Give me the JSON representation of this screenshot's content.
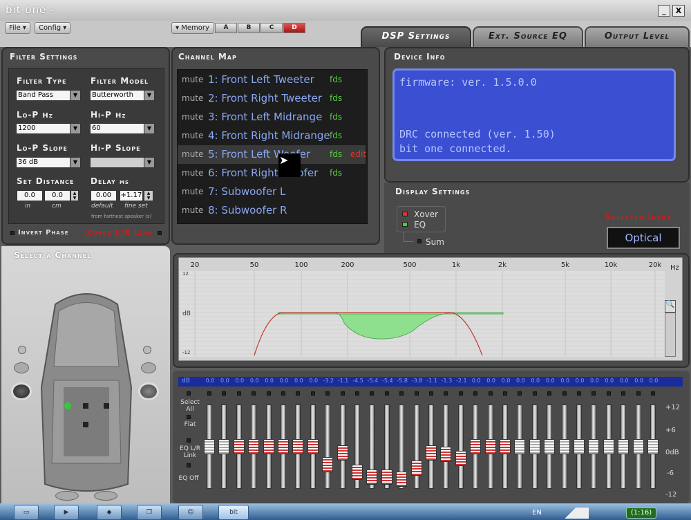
{
  "window": {
    "title": "bit one -",
    "minimize_label": "_",
    "close_label": "X"
  },
  "menu": {
    "file": "File",
    "config": "Config"
  },
  "memory": {
    "label": "Memory",
    "slots": [
      "A",
      "B",
      "C",
      "D"
    ],
    "active": "D"
  },
  "tabs": [
    "DSP Settings",
    "Ext. Source EQ",
    "Output Level"
  ],
  "filter_settings": {
    "title": "Filter Settings",
    "filter_type_label": "Filter Type",
    "filter_type_value": "Band Pass",
    "filter_model_label": "Filter Model",
    "filter_model_value": "Butterworth",
    "lop_label": "Lo-P",
    "lop_unit": "Hz",
    "lop_value": "1200",
    "hip_label": "Hi-P",
    "hip_unit": "Hz",
    "hip_value": "60",
    "lop_slope_label": "Lo-P Slope",
    "lop_slope_value": "36 dB",
    "hip_slope_label": "Hi-P Slope",
    "hip_slope_value": "",
    "distance_label": "Set Distance",
    "distance_in": "0.0",
    "distance_cm": "0.0",
    "in_label": "in",
    "cm_label": "cm",
    "delay_label": "Delay",
    "delay_unit": "ms",
    "delay_default": "0.00",
    "delay_fine": "+1.17",
    "default_label": "default",
    "fine_set_label": "fine set",
    "from_label": "from farthest speaker (s)",
    "invert_phase": "Invert Phase",
    "xover_link": "Xover L/R Link"
  },
  "channel_map": {
    "title": "Channel Map",
    "mute_label": "mute",
    "fds_label": "fds",
    "edit_label": "edit",
    "channels": [
      "1: Front Left Tweeter",
      "2: Front Right Tweeter",
      "3: Front Left Midrange",
      "4: Front Right Midrange",
      "5: Front Left Woofer",
      "6: Front Right Woofer",
      "7: Subwoofer L",
      "8: Subwoofer R"
    ],
    "selected": 5
  },
  "device_info": {
    "title": "Device Info",
    "firmware": "firmware: ver. 1.5.0.0",
    "drc": "DRC connected (ver. 1.50)",
    "bitone": "bit one connected."
  },
  "display_settings": {
    "title": "Display Settings",
    "xover": "Xover",
    "eq": "EQ",
    "sum": "Sum",
    "selected_input_label": "Selected Input",
    "selected_input_value": "Optical"
  },
  "select_channel": {
    "title": "Select a Channel"
  },
  "graph": {
    "freq_labels": [
      "20",
      "50",
      "100",
      "200",
      "500",
      "1k",
      "2k",
      "5k",
      "10k",
      "20k"
    ],
    "freq_unit": "Hz",
    "db_labels": [
      "12",
      "dB",
      "-12"
    ],
    "zoom_icon": "magnifier-icon"
  },
  "eq": {
    "db_label": "dB",
    "band_values": [
      "0.0",
      "0.0",
      "0.0",
      "0.0",
      "0.0",
      "0.0",
      "0.0",
      "0.0",
      "-3.2",
      "-1.1",
      "-4.5",
      "-5.4",
      "-5.4",
      "-5.8",
      "-3.8",
      "-1.1",
      "-1.3",
      "-2.1",
      "0.0",
      "0.0",
      "0.0",
      "0.0",
      "0.0",
      "0.0",
      "0.0",
      "0.0",
      "0.0",
      "0.0",
      "0.0",
      "0.0",
      "0.0"
    ],
    "red_bands": [
      2,
      3,
      4,
      5,
      6,
      7,
      8,
      9,
      10,
      11,
      12,
      13,
      14,
      15,
      16,
      17,
      18,
      19,
      20
    ],
    "select_all": "Select All",
    "flat": "Flat",
    "eq_link": "EQ L/R Link",
    "eq_off": "EQ Off",
    "scale": [
      "+12",
      "+6",
      "0dB",
      "-6",
      "-12"
    ],
    "range": [
      -12,
      12
    ]
  },
  "taskbar": {
    "lang": "EN",
    "clock": "(1:16)",
    "bit_label": "bit"
  }
}
